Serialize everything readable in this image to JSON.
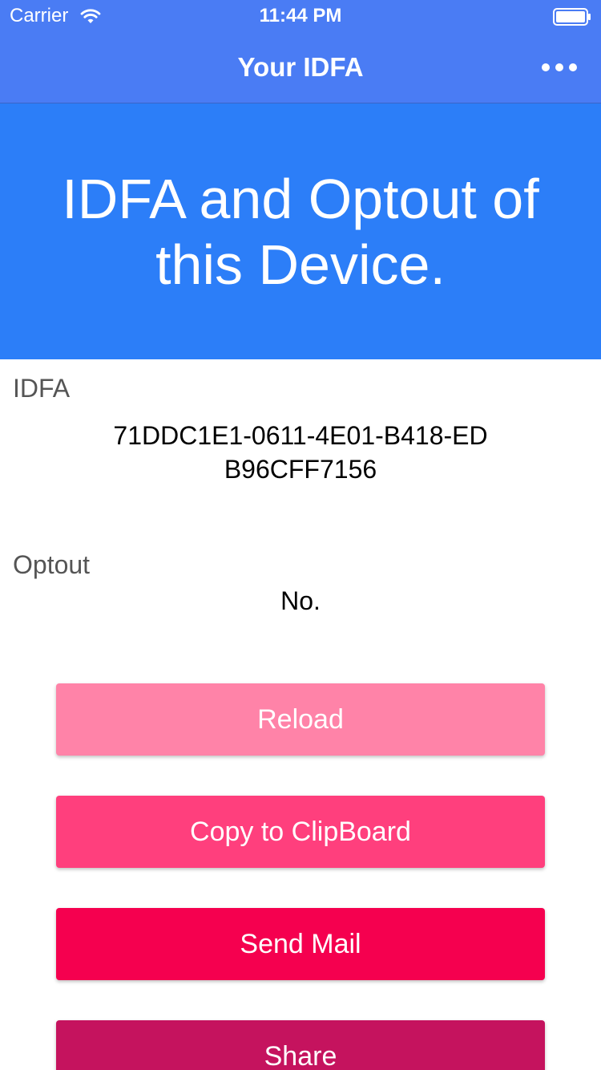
{
  "status_bar": {
    "carrier": "Carrier",
    "time": "11:44 PM"
  },
  "nav": {
    "title": "Your IDFA",
    "more_icon": "more-horizontal-icon"
  },
  "hero": {
    "title": "IDFA and Optout of this Device."
  },
  "idfa": {
    "label": "IDFA",
    "value": "71DDC1E1-0611-4E01-B418-EDB96CFF7156"
  },
  "optout": {
    "label": "Optout",
    "value": "No."
  },
  "buttons": {
    "reload": "Reload",
    "copy": "Copy to ClipBoard",
    "mail": "Send Mail",
    "share": "Share"
  },
  "colors": {
    "nav_background": "#4a7cf4",
    "hero_background": "#2c7ef8",
    "reload_button": "#ff83a8",
    "copy_button": "#ff3f7d",
    "mail_button": "#f5004f",
    "share_button": "#c5135e"
  }
}
